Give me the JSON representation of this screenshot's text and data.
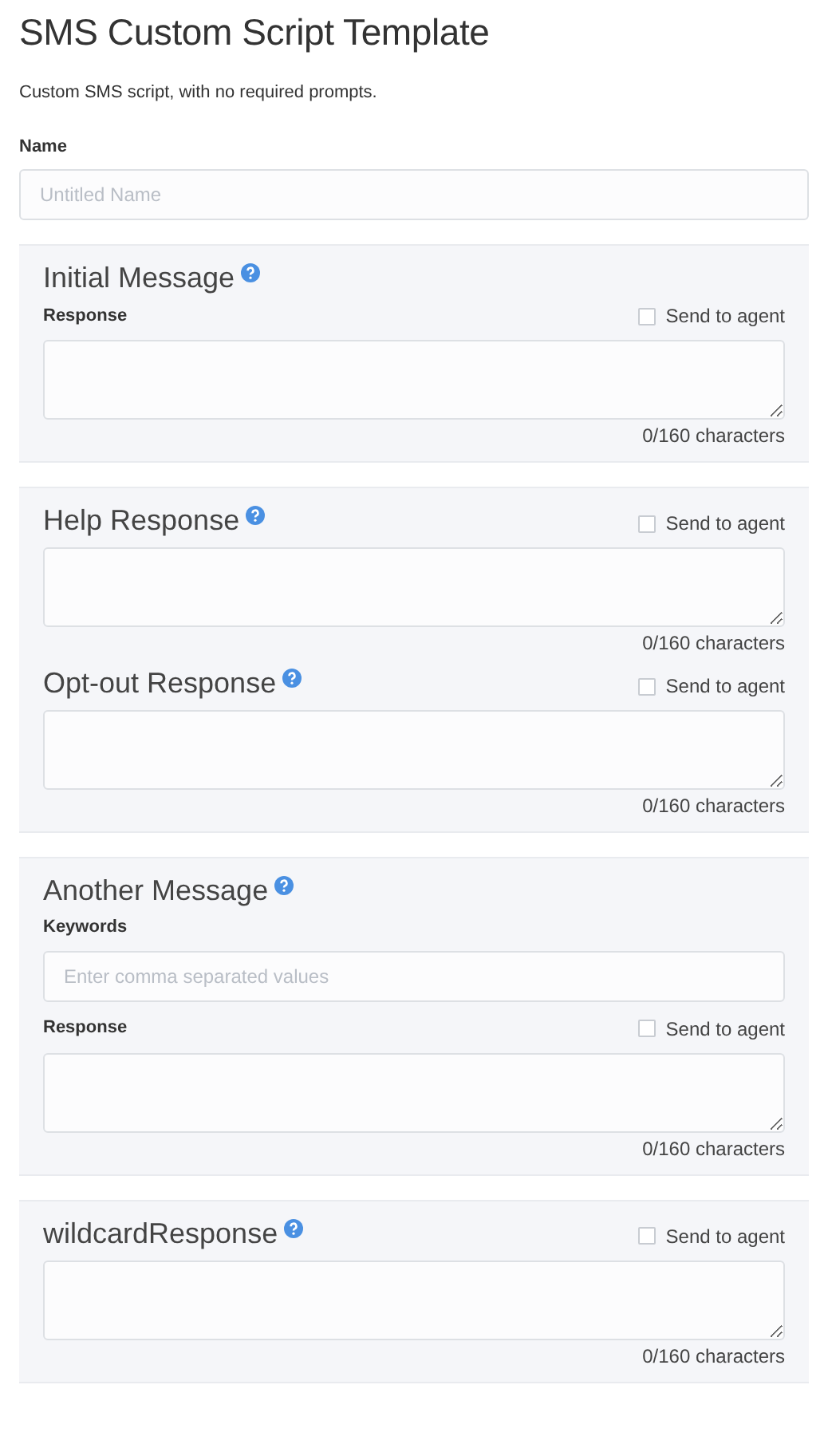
{
  "title": "SMS Custom Script Template",
  "description": "Custom SMS script, with no required prompts.",
  "name_field": {
    "label": "Name",
    "placeholder": "Untitled Name"
  },
  "sections": [
    {
      "blocks": [
        {
          "title": "Initial Message",
          "fields": [
            {
              "kind": "textarea",
              "label": "Response",
              "send_to_agent": {
                "label": "Send to agent",
                "checked": false
              },
              "counter": "0/160 characters"
            }
          ]
        }
      ]
    },
    {
      "blocks": [
        {
          "title": "Help Response",
          "fields": [
            {
              "kind": "textarea",
              "send_to_agent": {
                "label": "Send to agent",
                "checked": false
              },
              "counter": "0/160 characters"
            }
          ]
        },
        {
          "title": "Opt-out Response",
          "fields": [
            {
              "kind": "textarea",
              "send_to_agent": {
                "label": "Send to agent",
                "checked": false
              },
              "counter": "0/160 characters"
            }
          ]
        }
      ]
    },
    {
      "blocks": [
        {
          "title": "Another Message",
          "fields": [
            {
              "kind": "input",
              "label": "Keywords",
              "placeholder": "Enter comma separated values"
            },
            {
              "kind": "textarea",
              "label": "Response",
              "send_to_agent": {
                "label": "Send to agent",
                "checked": false
              },
              "counter": "0/160 characters"
            }
          ]
        }
      ]
    },
    {
      "blocks": [
        {
          "title": "wildcardResponse",
          "fields": [
            {
              "kind": "textarea",
              "send_to_agent": {
                "label": "Send to agent",
                "checked": false
              },
              "counter": "0/160 characters"
            }
          ]
        }
      ]
    }
  ]
}
